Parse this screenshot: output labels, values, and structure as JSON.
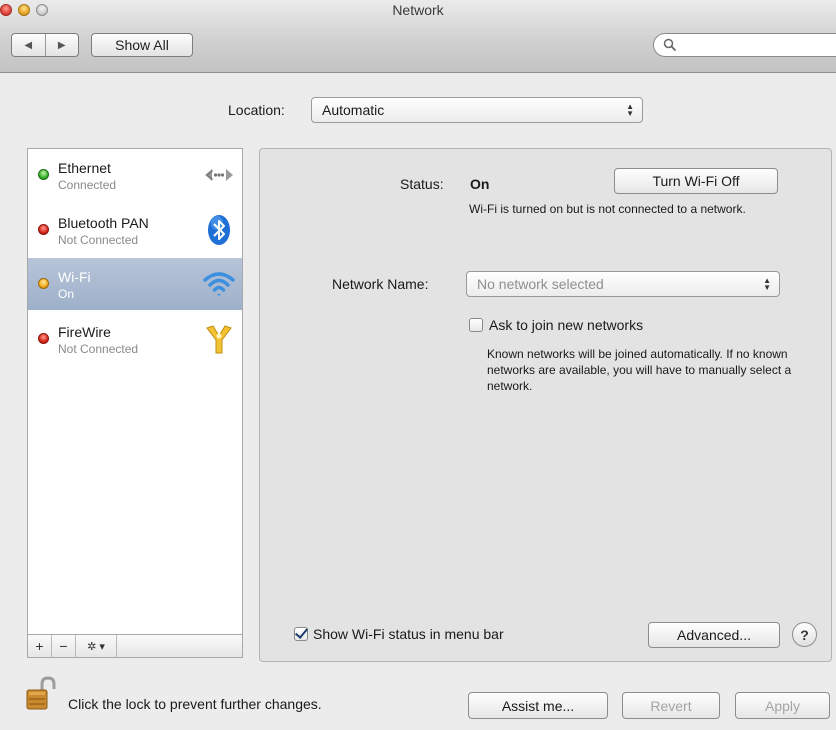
{
  "window": {
    "title": "Network"
  },
  "toolbar": {
    "back_glyph": "◀",
    "forward_glyph": "▶",
    "show_all": "Show All",
    "search_placeholder": ""
  },
  "location": {
    "label": "Location:",
    "value": "Automatic"
  },
  "services": [
    {
      "name": "Ethernet",
      "status": "Connected",
      "state": "green",
      "icon": "ethernet-icon"
    },
    {
      "name": "Bluetooth PAN",
      "status": "Not Connected",
      "state": "red",
      "icon": "bluetooth-icon"
    },
    {
      "name": "Wi-Fi",
      "status": "On",
      "state": "yellow",
      "icon": "wifi-icon",
      "selected": true
    },
    {
      "name": "FireWire",
      "status": "Not Connected",
      "state": "red",
      "icon": "firewire-icon"
    }
  ],
  "sidebar_tools": {
    "add": "+",
    "remove": "−",
    "gear": "✲ ▾"
  },
  "detail": {
    "status_label": "Status:",
    "status_value": "On",
    "turn_off_button": "Turn Wi-Fi Off",
    "status_note": "Wi-Fi is turned on but is not connected to a network.",
    "network_name_label": "Network Name:",
    "network_name_value": "No network selected",
    "ask_join_label": "Ask to join new networks",
    "ask_join_checked": false,
    "ask_join_note": "Known networks will be joined automatically. If no known networks are available, you will have to manually select a network.",
    "show_status_label": "Show Wi-Fi status in menu bar",
    "show_status_checked": true,
    "advanced_button": "Advanced...",
    "help_button": "?"
  },
  "footer": {
    "lock_text": "Click the lock to prevent further changes.",
    "assist_button": "Assist me...",
    "revert_button": "Revert",
    "apply_button": "Apply"
  },
  "colors": {
    "selected_row": "#a8b8d0",
    "status_green": "#36b22a",
    "status_red": "#d9251a",
    "status_yellow": "#f0a91b"
  }
}
